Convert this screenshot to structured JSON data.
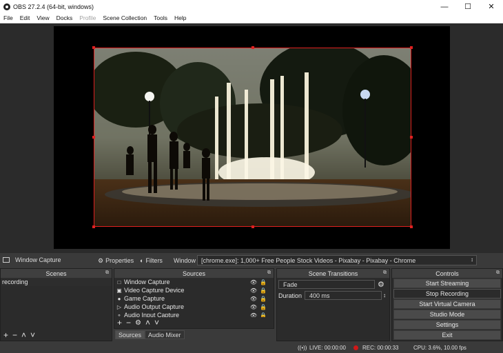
{
  "window": {
    "title": "OBS 27.2.4 (64-bit, windows)",
    "minimize": "—",
    "maximize": "☐",
    "close": "✕"
  },
  "menu": [
    {
      "label": "File",
      "disabled": false
    },
    {
      "label": "Edit",
      "disabled": false
    },
    {
      "label": "View",
      "disabled": false
    },
    {
      "label": "Docks",
      "disabled": false
    },
    {
      "label": "Profile",
      "disabled": true
    },
    {
      "label": "Scene Collection",
      "disabled": false
    },
    {
      "label": "Tools",
      "disabled": false
    },
    {
      "label": "Help",
      "disabled": false
    }
  ],
  "source_bar": {
    "source_name": "Window Capture",
    "properties_label": "Properties",
    "filters_label": "Filters",
    "window_label": "Window",
    "window_value": "[chrome.exe]: 1,000+ Free People Stock Videos - Pixabay - Pixabay - Chrome"
  },
  "scenes": {
    "title": "Scenes",
    "items": [
      "recording"
    ]
  },
  "sources": {
    "title": "Sources",
    "items": [
      {
        "label": "Window Capture",
        "icon": "window-icon"
      },
      {
        "label": "Video Capture Device",
        "icon": "camera-icon"
      },
      {
        "label": "Game Capture",
        "icon": "gamepad-icon"
      },
      {
        "label": "Audio Output Capture",
        "icon": "speaker-icon"
      },
      {
        "label": "Audio Input Capture",
        "icon": "microphone-icon"
      }
    ]
  },
  "tabs": {
    "sources": "Sources",
    "audio_mixer": "Audio Mixer"
  },
  "transitions": {
    "title": "Scene Transitions",
    "type": "Fade",
    "duration_label": "Duration",
    "duration_value": "400 ms"
  },
  "controls": {
    "title": "Controls",
    "start_streaming": "Start Streaming",
    "stop_recording": "Stop Recording",
    "start_virtual_camera": "Start Virtual Camera",
    "studio_mode": "Studio Mode",
    "settings": "Settings",
    "exit": "Exit"
  },
  "status": {
    "live": "LIVE: 00:00:00",
    "rec": "REC: 00:00:33",
    "cpu": "CPU: 3.6%, 10.00 fps"
  },
  "colors": {
    "selection": "#e02020",
    "rec_dot": "#d01818"
  }
}
